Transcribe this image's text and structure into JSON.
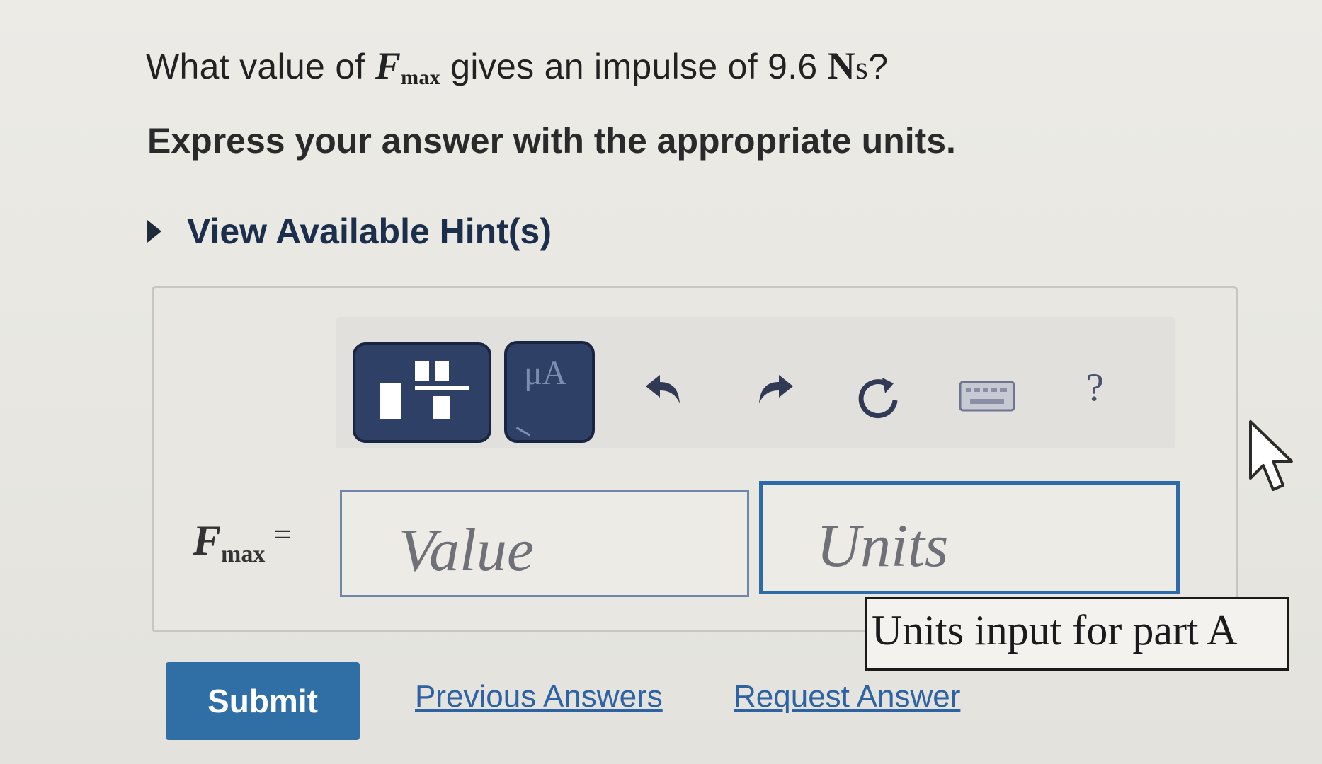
{
  "question": {
    "prefix": "What value of ",
    "var_main": "F",
    "var_sub": "max",
    "middle": " gives an impulse of 9.6 ",
    "unit_N": "N",
    "unit_s": "s",
    "suffix": "?"
  },
  "instruction": "Express your answer with the appropriate units.",
  "hints": {
    "label": "View Available Hint(s)"
  },
  "toolbar": {
    "symbols_label": "μA",
    "help_label": "?"
  },
  "answer": {
    "var_main": "F",
    "var_sub": "max",
    "equals": "=",
    "value_placeholder": "Value",
    "units_placeholder": "Units",
    "tooltip": "Units input for part A"
  },
  "actions": {
    "submit": "Submit",
    "previous_answers": "Previous Answers",
    "request_answer": "Request Answer"
  },
  "colors": {
    "submit_bg": "#2f6fa6",
    "link": "#2d62a4",
    "toolbar_button": "#2f4066",
    "units_border": "#2f6aa8"
  },
  "icons": [
    "templates-icon",
    "symbols-icon",
    "undo-icon",
    "redo-icon",
    "reset-icon",
    "keyboard-icon",
    "help-icon",
    "disclosure-triangle-icon",
    "mouse-cursor-icon"
  ]
}
